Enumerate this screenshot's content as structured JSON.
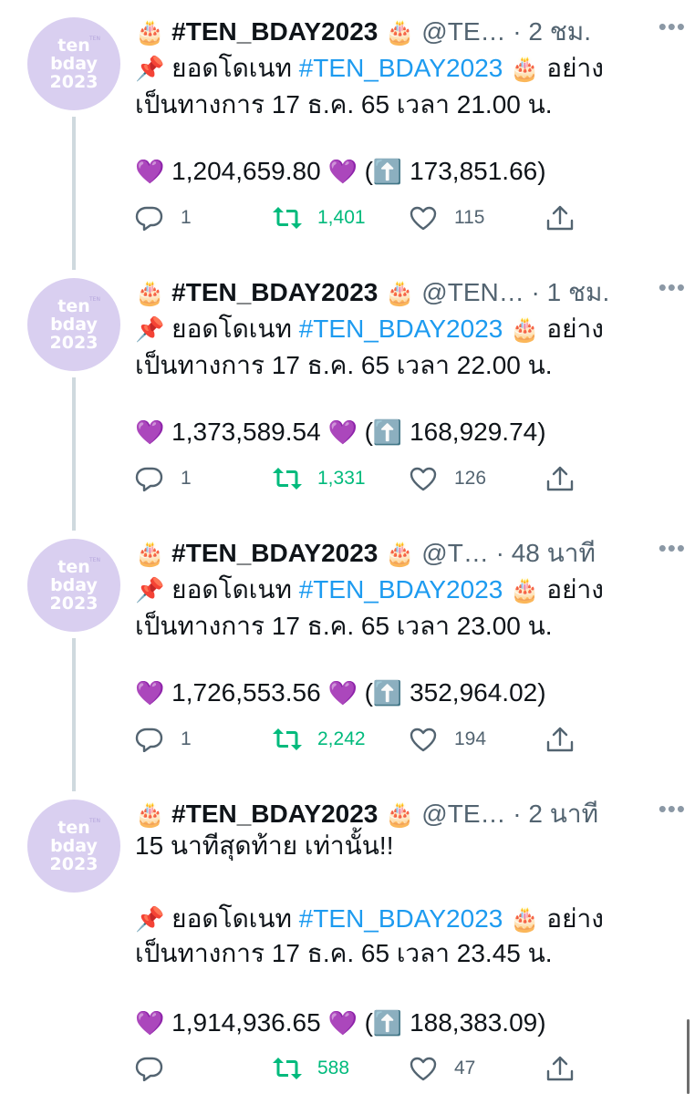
{
  "tweets": [
    {
      "name": "#TEN_BDAY2023",
      "handle": "@TE…",
      "dot": "·",
      "time": "2 ชม.",
      "more": "•••",
      "emoji_cake": "🎂",
      "emoji_pin": "📌",
      "emoji_heart": "💜",
      "emoji_up": "⬆️",
      "lines": [
        "ยอดโดเนท",
        "#TEN_BDAY2023",
        "อย่าง",
        "เป็นทางการ 17 ธ.ค. 65 เวลา 21.00 น."
      ],
      "amount": "1,204,659.80",
      "increase": "173,851.66",
      "replies": "1",
      "retweets": "1,401",
      "likes": "115"
    },
    {
      "name": "#TEN_BDAY2023",
      "handle": "@TEN…",
      "dot": "·",
      "time": "1 ชม.",
      "more": "•••",
      "emoji_cake": "🎂",
      "emoji_pin": "📌",
      "emoji_heart": "💜",
      "emoji_up": "⬆️",
      "lines": [
        "ยอดโดเนท",
        "#TEN_BDAY2023",
        "อย่าง",
        "เป็นทางการ 17 ธ.ค. 65 เวลา 22.00 น."
      ],
      "amount": "1,373,589.54",
      "increase": "168,929.74",
      "replies": "1",
      "retweets": "1,331",
      "likes": "126"
    },
    {
      "name": "#TEN_BDAY2023",
      "handle": "@T…",
      "dot": "·",
      "time": "48 นาที",
      "more": "•••",
      "emoji_cake": "🎂",
      "emoji_pin": "📌",
      "emoji_heart": "💜",
      "emoji_up": "⬆️",
      "lines": [
        "ยอดโดเนท",
        "#TEN_BDAY2023",
        "อย่าง",
        "เป็นทางการ 17 ธ.ค. 65 เวลา 23.00 น."
      ],
      "amount": "1,726,553.56",
      "increase": "352,964.02",
      "replies": "1",
      "retweets": "2,242",
      "likes": "194"
    },
    {
      "name": "#TEN_BDAY2023",
      "handle": "@TE…",
      "dot": "·",
      "time": "2 นาที",
      "more": "•••",
      "emoji_cake": "🎂",
      "emoji_pin": "📌",
      "emoji_heart": "💜",
      "emoji_up": "⬆️",
      "intro": "15 นาทีสุดท้าย เท่านั้น!!",
      "lines": [
        "ยอดโดเนท",
        "#TEN_BDAY2023",
        "อย่าง",
        "เป็นทางการ 17 ธ.ค. 65 เวลา 23.45 น."
      ],
      "amount": "1,914,936.65",
      "increase": "188,383.09",
      "replies": "",
      "retweets": "588",
      "likes": "47"
    }
  ],
  "avatar": {
    "line1": "ten",
    "line2": "bday",
    "line3": "2023",
    "mini": "TEN"
  },
  "colors": {
    "hashtag": "#1d9bf0",
    "retweet": "#00ba7c",
    "muted": "#536471",
    "avatar_bg": "#d9cff0"
  }
}
